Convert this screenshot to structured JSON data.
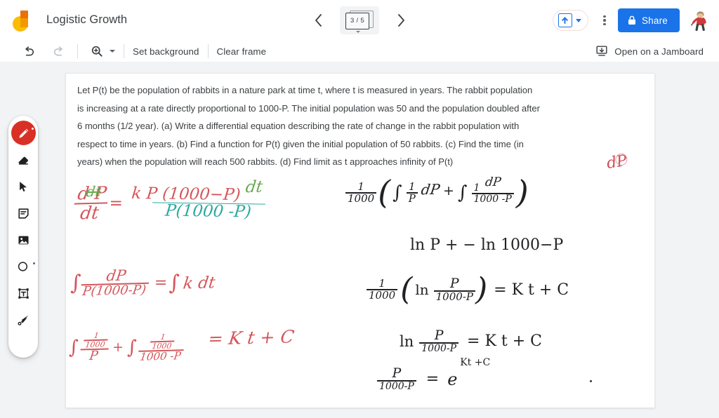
{
  "app": {
    "name": "Jamboard",
    "logo_icon": "jamboard-logo",
    "accent_blue": "#1a73e8",
    "pen_red": "#d93025",
    "canvas_bg": "#ffffff",
    "page_bg": "#f1f3f4"
  },
  "header": {
    "title": "Logistic Growth",
    "prev_frame_label": "‹",
    "next_frame_label": "›",
    "frame_counter": "3 / 5",
    "frame_current": 3,
    "frame_total": 5,
    "present_icon": "present-up-arrow-icon",
    "present_caret_icon": "chevron-down-icon",
    "more_menu_icon": "kebab-menu-icon",
    "share_label": "Share",
    "share_lock_icon": "lock-icon",
    "avatar_icon": "user-avatar"
  },
  "toolbar": {
    "undo_icon": "undo-icon",
    "redo_icon": "redo-icon",
    "zoom_icon": "zoom-in-icon",
    "zoom_caret_icon": "chevron-down-icon",
    "set_background_label": "Set background",
    "clear_frame_label": "Clear frame",
    "open_jamboard_label": "Open on a Jamboard",
    "open_jamboard_icon": "open-on-jamboard-icon"
  },
  "tool_rail": {
    "items": [
      {
        "name": "pen",
        "icon": "pen-icon",
        "active": true
      },
      {
        "name": "eraser",
        "icon": "eraser-icon",
        "active": false
      },
      {
        "name": "select",
        "icon": "cursor-select-icon",
        "active": false
      },
      {
        "name": "sticky-note",
        "icon": "sticky-note-icon",
        "active": false
      },
      {
        "name": "image",
        "icon": "image-icon",
        "active": false
      },
      {
        "name": "shape",
        "icon": "circle-shape-icon",
        "active": false
      },
      {
        "name": "text-box",
        "icon": "text-box-icon",
        "active": false
      },
      {
        "name": "laser-pointer",
        "icon": "laser-pointer-icon",
        "active": false
      }
    ]
  },
  "canvas": {
    "problem_text": "Let P(t) be the population of rabbits in a nature park at time t, where t is measured in years. The rabbit population is increasing at a rate directly proportional to 1000-P. The initial population was 50 and the population doubled after 6 months (1/2 year). (a) Write a differential equation describing the rate of change in the rabbit population with respect to time in years. (b) Find a function for P(t) given the initial population of 50 rabbits. (c) Find the time (in years) when the population will reach 500 rabbits. (d) Find limit as t approaches infinity of P(t)",
    "annotations": {
      "red_scribble": "dP",
      "left_column": {
        "eq1": {
          "lhs_num": "d P",
          "lhs_den": "dt",
          "lhs_strike": "dt",
          "equals": "=",
          "rhs_num": "k P (1000−P)",
          "rhs_den": "P(1000 -P)",
          "rhs_tail": "dt"
        },
        "eq2": {
          "integral": "∫",
          "num": "dP",
          "den": "P(1000-P)",
          "equals": "=",
          "rhs_integral": "∫",
          "rhs": "k dt"
        },
        "eq3": {
          "term1_integral": "∫",
          "term1_num": "1",
          "term1_num_den": "1000",
          "term1_den": "P",
          "plus": "+",
          "term2_integral": "∫",
          "term2_num": "1",
          "term2_num_den": "1000",
          "term2_den": "1000 -P",
          "equals_rhs": "= K t  + C"
        }
      },
      "right_column": {
        "eq1": {
          "coef_num": "1",
          "coef_den": "1000",
          "open_paren": "(",
          "i1": "∫",
          "i1_num": "1",
          "i1_den": "P",
          "i1_tail": "dP",
          "plus": "+",
          "i2": "∫",
          "i2_num": "1",
          "i2_num_sup": "dP",
          "i2_den": "1000 -P",
          "close_paren": ")"
        },
        "eq2": "ln P  + − ln 1000−P",
        "eq3": {
          "coef_num": "1",
          "coef_den": "1000",
          "body_ln": "ln",
          "body_num": "P",
          "body_den": "1000-P",
          "equals": "= K t + C"
        },
        "eq4": {
          "ln": "ln",
          "num": "P",
          "den": "1000-P",
          "equals": "= K t + C"
        },
        "eq5": {
          "num": "P",
          "den": "1000-P",
          "equals": "=",
          "base": "e",
          "exponent": "Kt +C"
        }
      }
    }
  }
}
